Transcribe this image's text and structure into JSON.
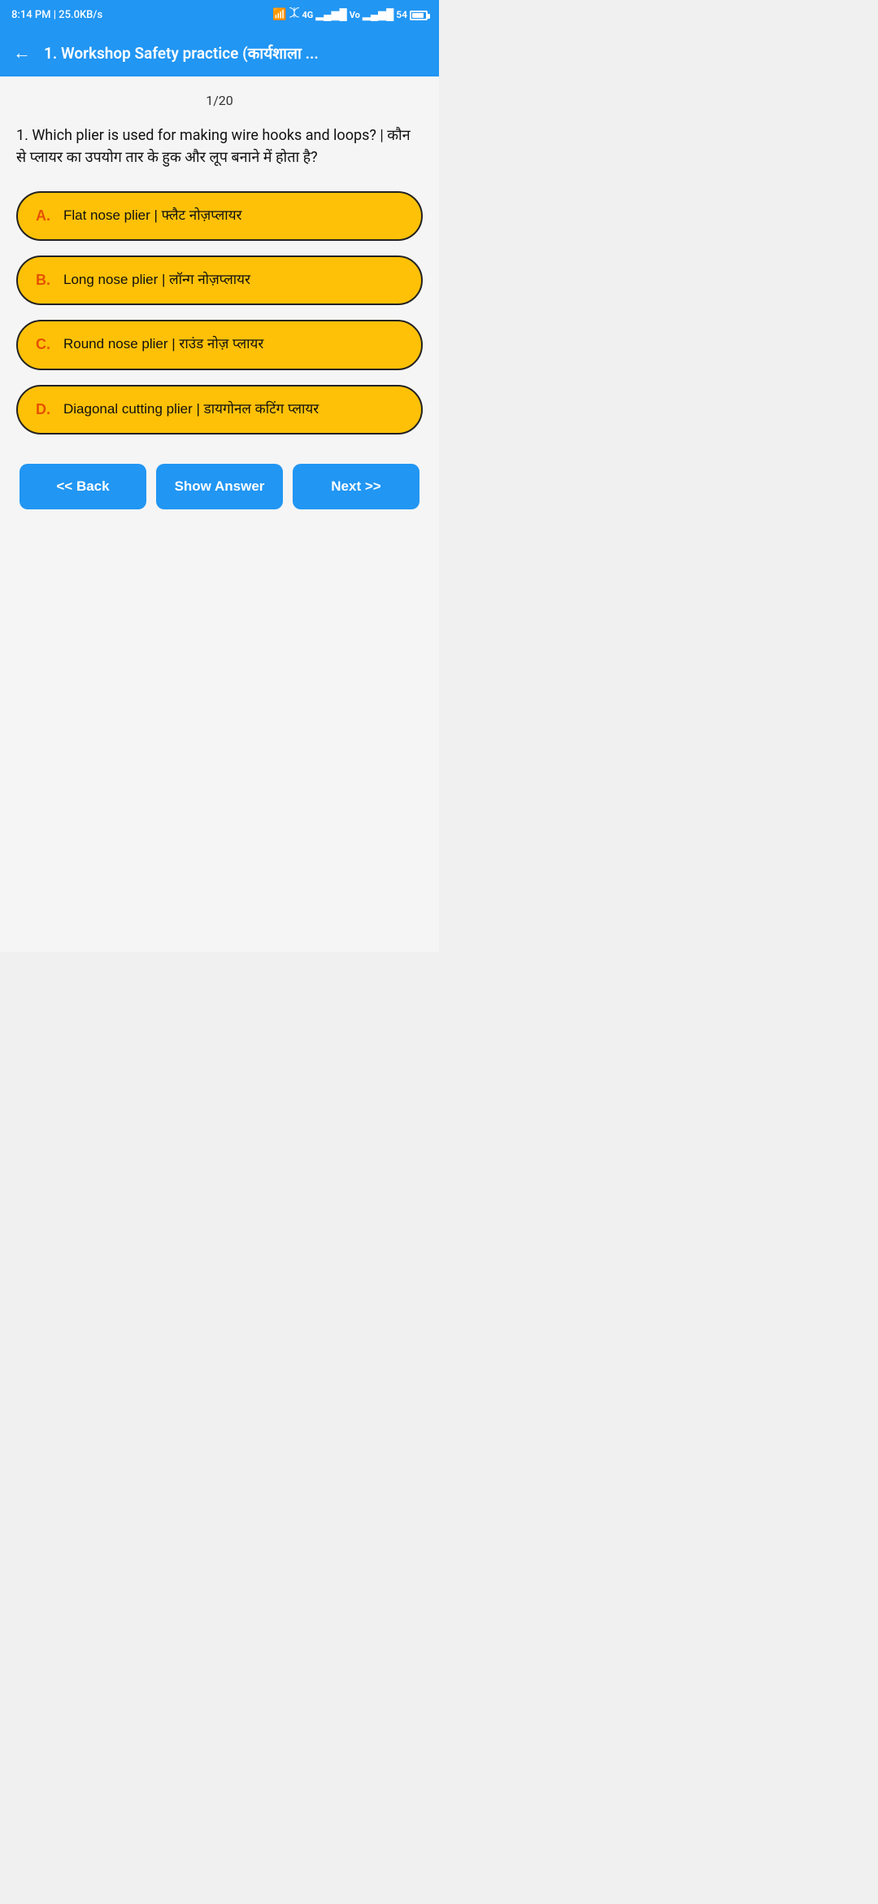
{
  "statusBar": {
    "time": "8:14 PM | 25.0KB/s",
    "batteryPercent": "54"
  },
  "appBar": {
    "backLabel": "←",
    "title": "1. Workshop Safety practice (कार्यशाला ..."
  },
  "main": {
    "progressLabel": "1/20",
    "questionText": "1. Which plier is used for making wire hooks and loops? | कौन से प्लायर का उपयोग तार के हुक और लूप बनाने में होता है?",
    "options": [
      {
        "letter": "A.",
        "text": "Flat nose plier | फ्लैट नोज़प्लायर"
      },
      {
        "letter": "B.",
        "text": "Long nose plier | लॉन्ग नोज़प्लायर"
      },
      {
        "letter": "C.",
        "text": "Round nose plier | राउंड नोज़ प्लायर"
      },
      {
        "letter": "D.",
        "text": "Diagonal cutting plier | डायगोनल कटिंग प्लायर"
      }
    ],
    "buttons": {
      "back": "<< Back",
      "showAnswer": "Show Answer",
      "next": "Next >>"
    }
  }
}
